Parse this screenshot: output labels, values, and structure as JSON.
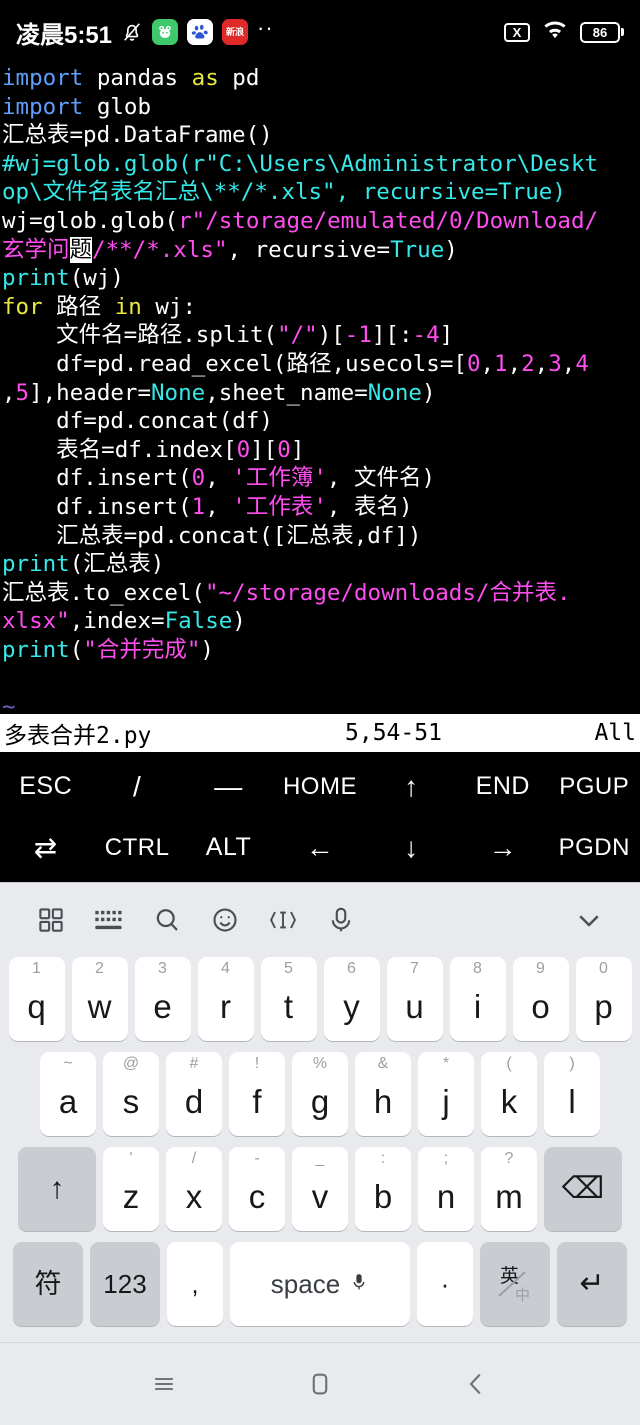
{
  "statusbar": {
    "time": "凌晨5:51",
    "icons": [
      {
        "name": "bell-mute-icon",
        "label": ""
      },
      {
        "name": "app-icon-green",
        "label": "🐸"
      },
      {
        "name": "app-icon-baidu",
        "label": ""
      },
      {
        "name": "app-icon-red",
        "label": "新浪"
      },
      {
        "name": "more-dots-icon",
        "label": "··"
      }
    ],
    "right": {
      "no_sim_label": "X",
      "wifi_label": "wifi-icon",
      "battery_level": "86"
    }
  },
  "editor": {
    "lines": [
      [
        {
          "t": "import ",
          "c": "blue"
        },
        {
          "t": "pandas ",
          "c": "white"
        },
        {
          "t": "as",
          "c": "yellow"
        },
        {
          "t": " pd",
          "c": "white"
        }
      ],
      [
        {
          "t": "import ",
          "c": "blue"
        },
        {
          "t": "glob",
          "c": "white"
        }
      ],
      [
        {
          "t": "汇总表=pd.DataFrame()",
          "c": "white"
        }
      ],
      [
        {
          "t": "#wj=glob.glob(r\"C:\\Users\\Administrator\\Deskt",
          "c": "cyan"
        }
      ],
      [
        {
          "t": "op\\文件名表名汇总\\**/*.xls\", recursive=True)",
          "c": "cyan"
        }
      ],
      [
        {
          "t": "wj=glob.glob(",
          "c": "white"
        },
        {
          "t": "r\"/storage/emulated/0/Download/",
          "c": "magenta"
        }
      ],
      [
        {
          "t": "玄学问",
          "c": "magenta"
        },
        {
          "t": "题",
          "c": "cursor"
        },
        {
          "t": "/**/*.xls\"",
          "c": "magenta"
        },
        {
          "t": ", recursive=",
          "c": "white"
        },
        {
          "t": "True",
          "c": "cyan"
        },
        {
          "t": ")",
          "c": "white"
        }
      ],
      [
        {
          "t": "print",
          "c": "cyan"
        },
        {
          "t": "(wj)",
          "c": "white"
        }
      ],
      [
        {
          "t": "for",
          "c": "yellow"
        },
        {
          "t": " 路径 ",
          "c": "white"
        },
        {
          "t": "in",
          "c": "yellow"
        },
        {
          "t": " wj:",
          "c": "white"
        }
      ],
      [
        {
          "t": "    文件名=路径.split(",
          "c": "white"
        },
        {
          "t": "\"/\"",
          "c": "magenta"
        },
        {
          "t": ")[",
          "c": "white"
        },
        {
          "t": "-1",
          "c": "magenta"
        },
        {
          "t": "][:",
          "c": "white"
        },
        {
          "t": "-4",
          "c": "magenta"
        },
        {
          "t": "]",
          "c": "white"
        }
      ],
      [
        {
          "t": "    df=pd.read_excel(路径,usecols=[",
          "c": "white"
        },
        {
          "t": "0",
          "c": "magenta"
        },
        {
          "t": ",",
          "c": "white"
        },
        {
          "t": "1",
          "c": "magenta"
        },
        {
          "t": ",",
          "c": "white"
        },
        {
          "t": "2",
          "c": "magenta"
        },
        {
          "t": ",",
          "c": "white"
        },
        {
          "t": "3",
          "c": "magenta"
        },
        {
          "t": ",",
          "c": "white"
        },
        {
          "t": "4",
          "c": "magenta"
        }
      ],
      [
        {
          "t": ",",
          "c": "white"
        },
        {
          "t": "5",
          "c": "magenta"
        },
        {
          "t": "],header=",
          "c": "white"
        },
        {
          "t": "None",
          "c": "cyan"
        },
        {
          "t": ",sheet_name=",
          "c": "white"
        },
        {
          "t": "None",
          "c": "cyan"
        },
        {
          "t": ")",
          "c": "white"
        }
      ],
      [
        {
          "t": "    df=pd.concat(df)",
          "c": "white"
        }
      ],
      [
        {
          "t": "    表名=df.index[",
          "c": "white"
        },
        {
          "t": "0",
          "c": "magenta"
        },
        {
          "t": "][",
          "c": "white"
        },
        {
          "t": "0",
          "c": "magenta"
        },
        {
          "t": "]",
          "c": "white"
        }
      ],
      [
        {
          "t": "    df.insert(",
          "c": "white"
        },
        {
          "t": "0",
          "c": "magenta"
        },
        {
          "t": ", ",
          "c": "white"
        },
        {
          "t": "'工作簿'",
          "c": "magenta"
        },
        {
          "t": ", 文件名)",
          "c": "white"
        }
      ],
      [
        {
          "t": "    df.insert(",
          "c": "white"
        },
        {
          "t": "1",
          "c": "magenta"
        },
        {
          "t": ", ",
          "c": "white"
        },
        {
          "t": "'工作表'",
          "c": "magenta"
        },
        {
          "t": ", 表名)",
          "c": "white"
        }
      ],
      [
        {
          "t": "    汇总表=pd.concat([汇总表,df])",
          "c": "white"
        }
      ],
      [
        {
          "t": "print",
          "c": "cyan"
        },
        {
          "t": "(汇总表)",
          "c": "white"
        }
      ],
      [
        {
          "t": "汇总表.to_excel(",
          "c": "white"
        },
        {
          "t": "\"~/storage/downloads/合并表.",
          "c": "magenta"
        }
      ],
      [
        {
          "t": "xlsx\"",
          "c": "magenta"
        },
        {
          "t": ",index=",
          "c": "white"
        },
        {
          "t": "False",
          "c": "cyan"
        },
        {
          "t": ")",
          "c": "white"
        }
      ],
      [
        {
          "t": "print",
          "c": "cyan"
        },
        {
          "t": "(",
          "c": "white"
        },
        {
          "t": "\"合并完成\"",
          "c": "magenta"
        },
        {
          "t": ")",
          "c": "white"
        }
      ],
      [],
      [
        {
          "t": "~",
          "c": "tilde"
        }
      ]
    ],
    "status": {
      "filename": "多表合并2.py",
      "position": "5,54-51",
      "scroll": "All"
    },
    "colors": {
      "background": "#000000",
      "keyword": "#e8e842",
      "builtin": "#36e8e8",
      "string": "#ff4df0",
      "comment": "#36e8e8",
      "import": "#5f9ffb",
      "text": "#ffffff"
    }
  },
  "extra_keys": {
    "row1": [
      "ESC",
      "/",
      "—",
      "HOME",
      "↑",
      "END",
      "PGUP"
    ],
    "row2": [
      "⇄",
      "CTRL",
      "ALT",
      "←",
      "↓",
      "→",
      "PGDN"
    ]
  },
  "keyboard": {
    "toolbar": [
      {
        "name": "grid-icon"
      },
      {
        "name": "keyboard-icon"
      },
      {
        "name": "search-icon"
      },
      {
        "name": "emoji-icon"
      },
      {
        "name": "text-cursor-icon"
      },
      {
        "name": "microphone-icon"
      },
      {
        "name": "chevron-down-icon"
      }
    ],
    "row1": [
      {
        "main": "q",
        "sub": "1"
      },
      {
        "main": "w",
        "sub": "2"
      },
      {
        "main": "e",
        "sub": "3"
      },
      {
        "main": "r",
        "sub": "4"
      },
      {
        "main": "t",
        "sub": "5"
      },
      {
        "main": "y",
        "sub": "6"
      },
      {
        "main": "u",
        "sub": "7"
      },
      {
        "main": "i",
        "sub": "8"
      },
      {
        "main": "o",
        "sub": "9"
      },
      {
        "main": "p",
        "sub": "0"
      }
    ],
    "row2": [
      {
        "main": "a",
        "sub": "~"
      },
      {
        "main": "s",
        "sub": "@"
      },
      {
        "main": "d",
        "sub": "#"
      },
      {
        "main": "f",
        "sub": "!"
      },
      {
        "main": "g",
        "sub": "%"
      },
      {
        "main": "h",
        "sub": "&"
      },
      {
        "main": "j",
        "sub": "*"
      },
      {
        "main": "k",
        "sub": "("
      },
      {
        "main": "l",
        "sub": ")"
      }
    ],
    "row3": {
      "shift": "↑",
      "keys": [
        {
          "main": "z",
          "sub": "'"
        },
        {
          "main": "x",
          "sub": "/"
        },
        {
          "main": "c",
          "sub": "-"
        },
        {
          "main": "v",
          "sub": "_"
        },
        {
          "main": "b",
          "sub": ":"
        },
        {
          "main": "n",
          "sub": ";"
        },
        {
          "main": "m",
          "sub": "?"
        }
      ],
      "backspace": "⌫"
    },
    "row4": {
      "symbol": "符",
      "numbers": "123",
      "comma": ",",
      "space": "space",
      "period": "·",
      "lang": {
        "top": "英",
        "bottom": "中"
      },
      "enter": "↵"
    }
  },
  "navbar": {
    "menu": "menu-icon",
    "home": "home-icon",
    "back": "back-icon"
  }
}
